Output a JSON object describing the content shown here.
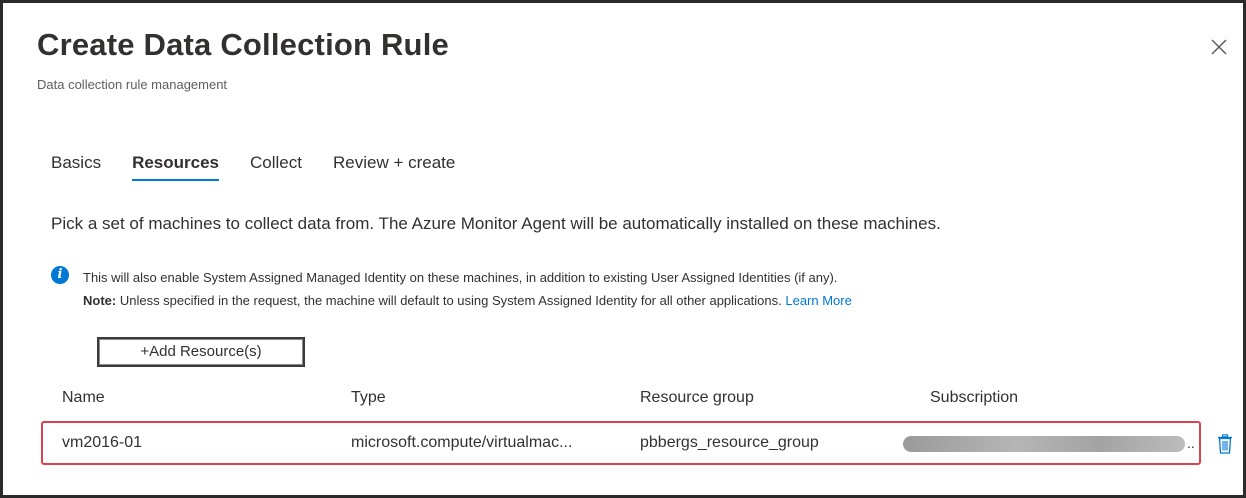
{
  "header": {
    "title": "Create Data Collection Rule",
    "subtitle": "Data collection rule management"
  },
  "tabs": [
    {
      "label": "Basics",
      "active": false
    },
    {
      "label": "Resources",
      "active": true
    },
    {
      "label": "Collect",
      "active": false
    },
    {
      "label": "Review + create",
      "active": false
    }
  ],
  "description": "Pick a set of machines to collect data from. The Azure Monitor Agent will be automatically installed on these machines.",
  "info": {
    "icon": "info-icon",
    "line1": "This will also enable System Assigned Managed Identity on these machines, in addition to existing User Assigned Identities (if any).",
    "note_label": "Note:",
    "line2": " Unless specified in the request, the machine will default to using System Assigned Identity for all other applications. ",
    "link": "Learn More"
  },
  "add_button_label": "+Add Resource(s)",
  "table": {
    "columns": [
      "Name",
      "Type",
      "Resource group",
      "Subscription"
    ],
    "rows": [
      {
        "name": "vm2016-01",
        "type": "microsoft.compute/virtualmac...",
        "resource_group": "pbbergs_resource_group",
        "subscription_suffix": ".."
      }
    ]
  },
  "colors": {
    "accent": "#0078d4",
    "highlight_border": "#d9424f",
    "text": "#323130"
  }
}
